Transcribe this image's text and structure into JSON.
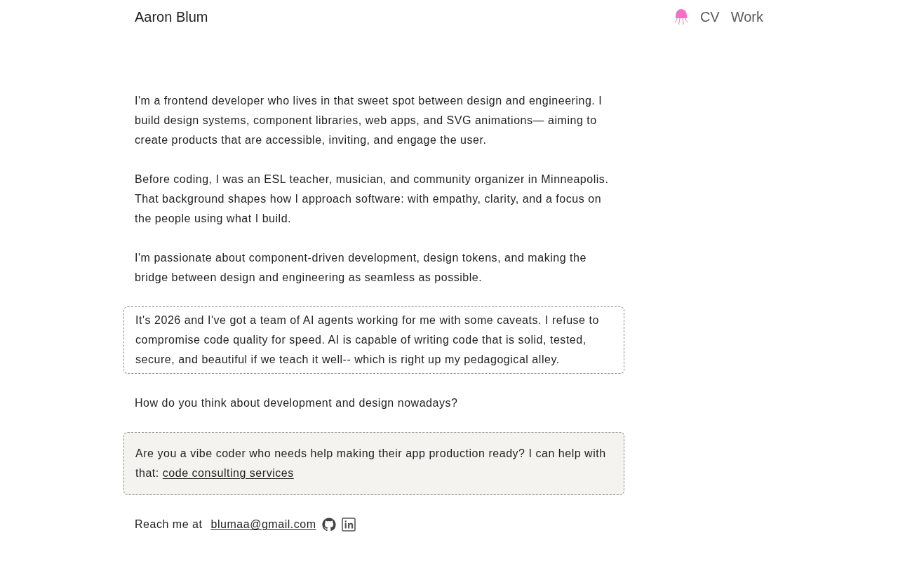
{
  "header": {
    "name": "Aaron Blum",
    "nav": [
      "CV",
      "Work"
    ]
  },
  "intro": [
    "I'm a frontend developer who lives in that sweet spot between design and engineering. I build design systems, component libraries, web apps, and SVG animations— aiming to create products that are accessible, inviting, and engage the user.",
    "Before coding, I was an ESL teacher, musician, and community organizer in Minneapolis. That background shapes how I approach software: with empathy, clarity, and a focus on the people using what I build.",
    "I'm passionate about component-driven development, design tokens, and making the bridge between design and engineering as seamless as possible."
  ],
  "ai_note": "It's 2026 and I've got a team of AI agents working for me with some caveats. I refuse to compromise code quality for speed. AI is capable of writing code that is solid, tested, secure, and beautiful if we teach it well-- which is right up my pedagogical alley.",
  "question": "How do you think about development and design nowadays?",
  "consulting": {
    "text": "Are you a vibe coder who needs help making their app production ready? I can help with that:",
    "link": "code consulting services"
  },
  "contact": {
    "label": "Reach me at",
    "email": "blumaa@gmail.com"
  }
}
